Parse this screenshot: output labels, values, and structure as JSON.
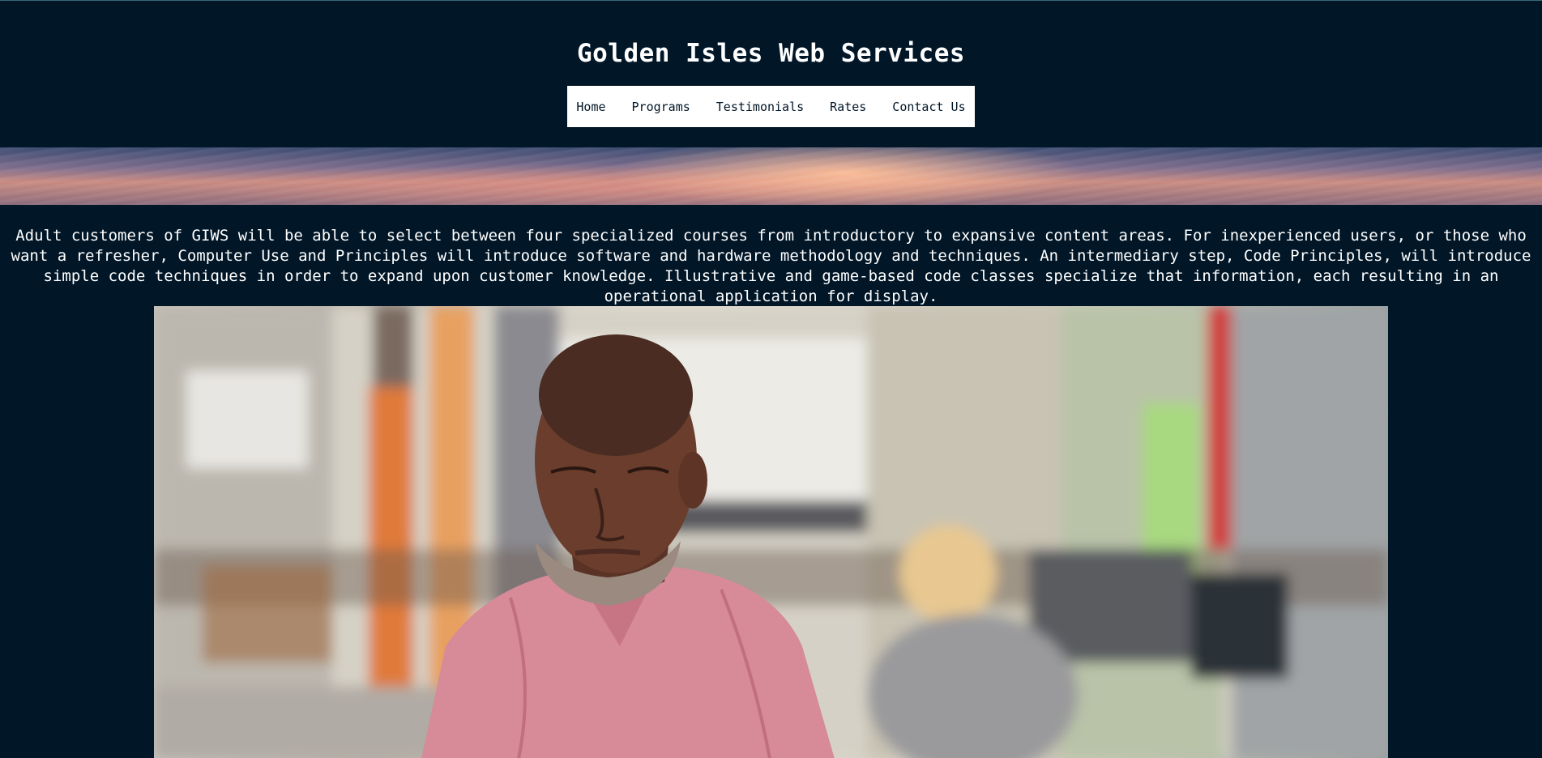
{
  "site": {
    "title": "Golden Isles Web Services"
  },
  "nav": {
    "items": [
      {
        "label": "Home"
      },
      {
        "label": "Programs"
      },
      {
        "label": "Testimonials"
      },
      {
        "label": "Rates"
      },
      {
        "label": "Contact Us"
      }
    ]
  },
  "intro": {
    "text": "Adult customers of GIWS will be able to select between four specialized courses from introductory to expansive content areas. For inexperienced users, or those who want a refresher, Computer Use and Principles will introduce software and hardware methodology and techniques. An intermediary step, Code Principles, will introduce simple code techniques in order to expand upon customer knowledge. Illustrative and game-based code classes specialize that information, each resulting in an operational application for display."
  },
  "colors": {
    "background": "#011627",
    "nav_background": "#ffffff",
    "nav_text": "#011627",
    "text": "#ffffff"
  }
}
